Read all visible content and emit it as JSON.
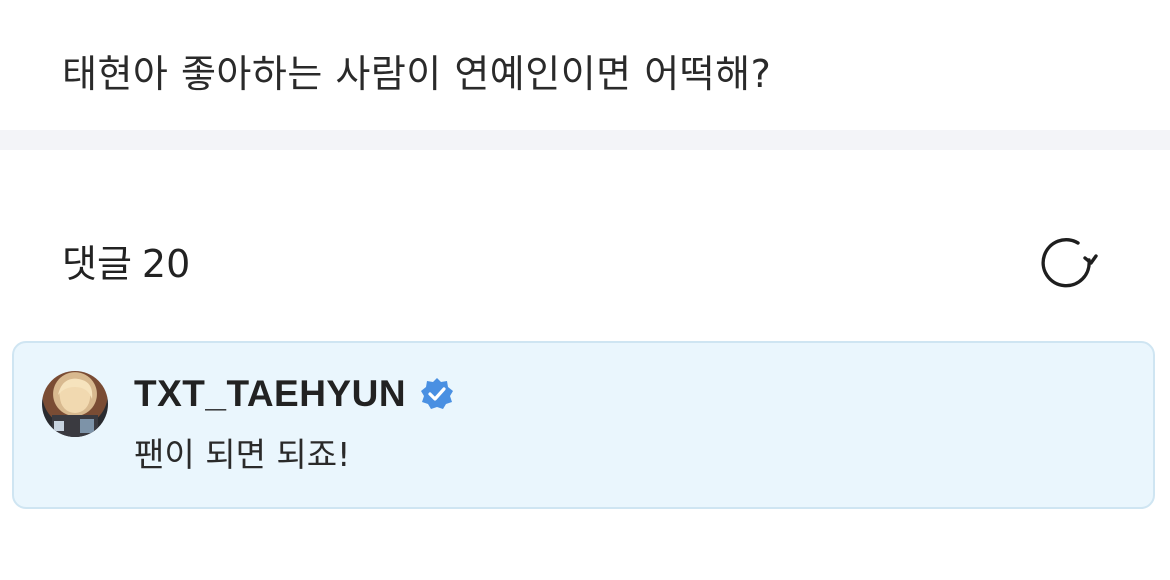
{
  "post": {
    "title": "태현아 좋아하는 사람이 연예인이면 어떡해?"
  },
  "comments": {
    "label": "댓글",
    "count": "20",
    "refresh_icon": "refresh-icon",
    "items": [
      {
        "author": "TXT_TAEHYUN",
        "verified": true,
        "text": "팬이 되면 되죠!",
        "highlight_color": "#eaf6fd"
      }
    ]
  },
  "colors": {
    "verified_badge": "#4a90e2",
    "divider": "#f3f4f8",
    "card_border": "#cfe5f2"
  }
}
